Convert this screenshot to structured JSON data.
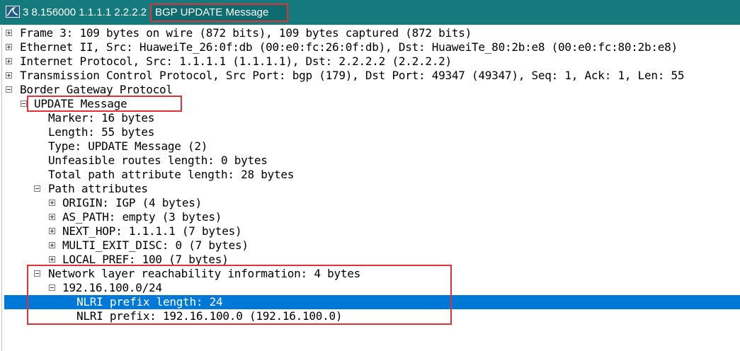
{
  "window": {
    "title_prefix": "3 8.156000 1.1.1.1 2.2.2.2",
    "title_highlight": "BGP UPDATE Message",
    "accent_color": "#147a7d",
    "highlight_color": "#e03236",
    "selection_color": "#0078d7"
  },
  "tree": [
    {
      "text": "Frame 3: 109 bytes on wire (872 bits), 109 bytes captured (872 bits)",
      "toggle": "plus",
      "level": 0
    },
    {
      "text": "Ethernet II, Src: HuaweiTe_26:0f:db (00:e0:fc:26:0f:db), Dst: HuaweiTe_80:2b:e8 (00:e0:fc:80:2b:e8)",
      "toggle": "plus",
      "level": 0
    },
    {
      "text": "Internet Protocol, Src: 1.1.1.1 (1.1.1.1), Dst: 2.2.2.2 (2.2.2.2)",
      "toggle": "plus",
      "level": 0
    },
    {
      "text": "Transmission Control Protocol, Src Port: bgp (179), Dst Port: 49347 (49347), Seq: 1, Ack: 1, Len: 55",
      "toggle": "plus",
      "level": 0
    },
    {
      "text": "Border Gateway Protocol",
      "toggle": "minus",
      "level": 0
    },
    {
      "text": "UPDATE Message",
      "toggle": "minus",
      "level": 1
    },
    {
      "text": "Marker: 16 bytes",
      "toggle": "none",
      "level": 2
    },
    {
      "text": "Length: 55 bytes",
      "toggle": "none",
      "level": 2
    },
    {
      "text": "Type: UPDATE Message (2)",
      "toggle": "none",
      "level": 2
    },
    {
      "text": "Unfeasible routes length: 0 bytes",
      "toggle": "none",
      "level": 2
    },
    {
      "text": "Total path attribute length: 28 bytes",
      "toggle": "none",
      "level": 2
    },
    {
      "text": "Path attributes",
      "toggle": "minus",
      "level": 2
    },
    {
      "text": "ORIGIN: IGP (4 bytes)",
      "toggle": "plus",
      "level": 3
    },
    {
      "text": "AS_PATH: empty (3 bytes)",
      "toggle": "plus",
      "level": 3
    },
    {
      "text": "NEXT_HOP: 1.1.1.1 (7 bytes)",
      "toggle": "plus",
      "level": 3
    },
    {
      "text": "MULTI_EXIT_DISC: 0 (7 bytes)",
      "toggle": "plus",
      "level": 3
    },
    {
      "text": "LOCAL_PREF: 100 (7 bytes)",
      "toggle": "plus",
      "level": 3
    },
    {
      "text": "Network layer reachability information: 4 bytes",
      "toggle": "minus",
      "level": 2
    },
    {
      "text": "192.16.100.0/24",
      "toggle": "minus",
      "level": 3
    },
    {
      "text": "NLRI prefix length: 24",
      "toggle": "none",
      "level": 4,
      "selected": true
    },
    {
      "text": "NLRI prefix: 192.16.100.0 (192.16.100.0)",
      "toggle": "none",
      "level": 4
    }
  ]
}
